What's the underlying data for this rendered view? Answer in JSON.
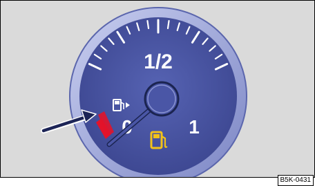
{
  "gauge": {
    "label_half": "1/2",
    "label_full": "1",
    "label_empty": "0",
    "face_color": "#4a56a6",
    "rim_color": "#9ea7d8",
    "reserve_color": "#e2132a",
    "fuel_icon_color": "#f2c21a",
    "icons": [
      "fuel-pump-filler-side-icon",
      "fuel-pump-warning-icon"
    ]
  },
  "figure_code": "B5K-0431"
}
